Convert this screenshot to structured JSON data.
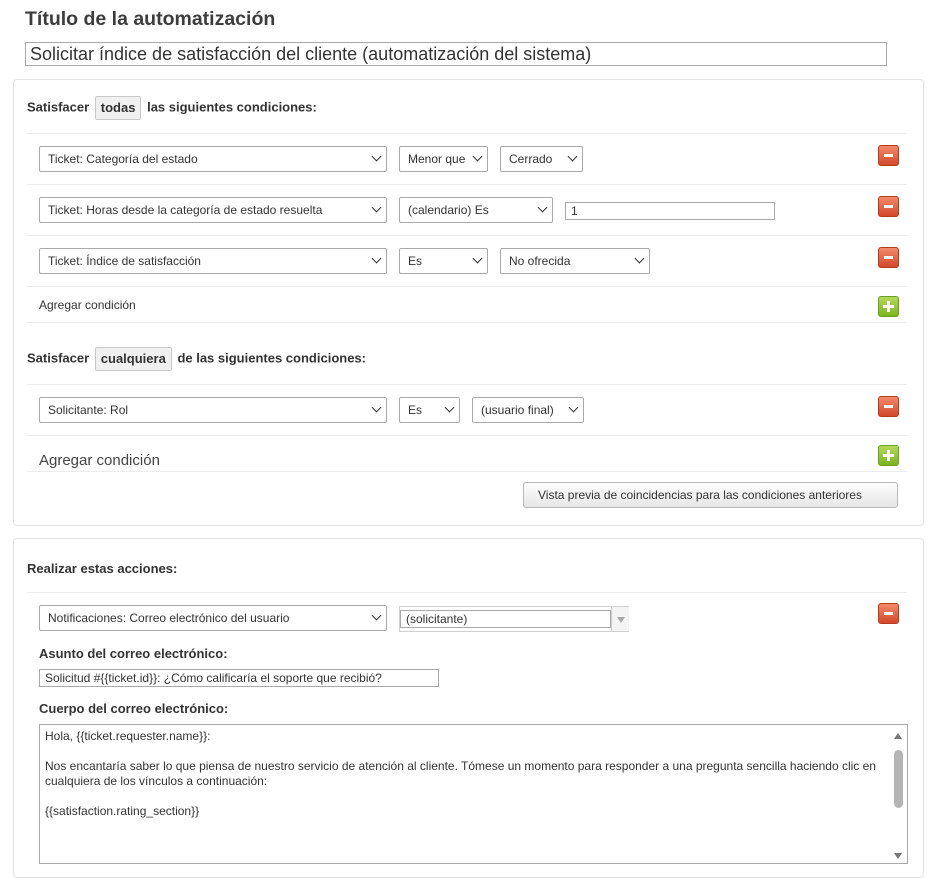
{
  "automation": {
    "title_label": "Título de la automatización",
    "title_value": "Solicitar índice de satisfacción del cliente (automatización del sistema)"
  },
  "conditions_all": {
    "prefix": "Satisfacer",
    "mode": "todas",
    "suffix": "las siguientes condiciones:",
    "rows": [
      {
        "field": "Ticket: Categoría del estado",
        "operator": "Menor que",
        "value": "Cerrado"
      },
      {
        "field": "Ticket: Horas desde la categoría de estado resuelta",
        "operator": "(calendario) Es",
        "value": "1"
      },
      {
        "field": "Ticket: Índice de satisfacción",
        "operator": "Es",
        "value": "No ofrecida"
      }
    ],
    "add_label": "Agregar condición"
  },
  "conditions_any": {
    "prefix": "Satisfacer",
    "mode": "cualquiera",
    "suffix": "de las siguientes condiciones:",
    "rows": [
      {
        "field": "Solicitante: Rol",
        "operator": "Es",
        "value": "(usuario final)"
      }
    ],
    "add_label": "Agregar condición",
    "preview_button": "Vista previa de coincidencias para las condiciones anteriores"
  },
  "actions": {
    "heading": "Realizar estas acciones:",
    "rows": [
      {
        "action": "Notificaciones: Correo electrónico del usuario",
        "target": "(solicitante)"
      }
    ],
    "subject_label": "Asunto del correo electrónico:",
    "subject_value": "Solicitud #{{ticket.id}}: ¿Cómo calificaría el soporte que recibió?",
    "body_label": "Cuerpo del correo electrónico:",
    "body_lines": [
      "Hola, {{ticket.requester.name}}:",
      "",
      "Nos encantaría saber lo que piensa de nuestro servicio de atención al cliente. Tómese un momento para responder a una pregunta sencilla haciendo clic en cualquiera de los vínculos a continuación:",
      "",
      "{{satisfaction.rating_section}}"
    ]
  },
  "icons": {
    "remove": "minus-icon",
    "add": "plus-icon",
    "dropdown": "chevron-down-icon"
  },
  "colors": {
    "remove_button": "#d2482a",
    "add_button": "#7ab51d"
  }
}
